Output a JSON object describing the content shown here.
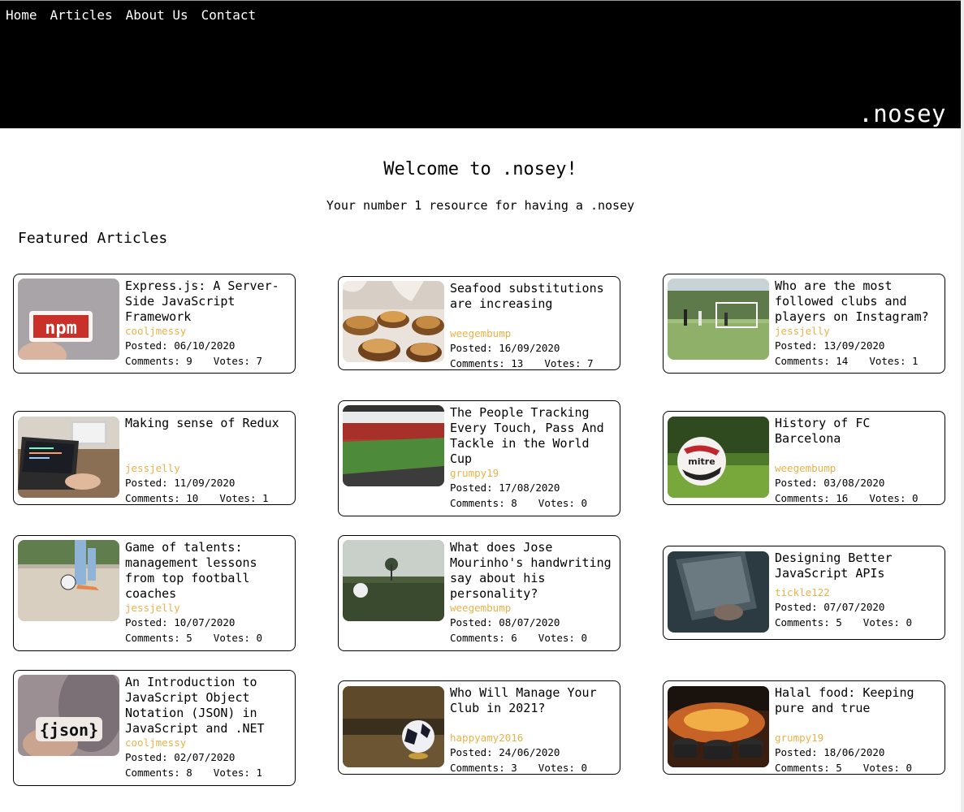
{
  "nav": {
    "items": [
      "Home",
      "Articles",
      "About Us",
      "Contact"
    ],
    "brand": ".nosey"
  },
  "intro": {
    "welcome": "Welcome to .nosey!",
    "tagline": "Your number 1 resource for having a .nosey",
    "featured": "Featured Articles"
  },
  "colors": {
    "author": "#e8b24a",
    "header_bg": "#000000"
  },
  "articles": [
    {
      "title": "Express.js: A Server-Side JavaScript Framework",
      "author": "cooljmessy",
      "posted": "Posted: 06/10/2020",
      "comments": "Comments: 9",
      "votes": "Votes: 7",
      "image": "npm-logo-photo"
    },
    {
      "title": "Seafood substitutions are increasing",
      "author": "weegembump",
      "posted": "Posted: 16/09/2020",
      "comments": "Comments: 13",
      "votes": "Votes: 7",
      "image": "seafood-dish-photo"
    },
    {
      "title": "Who are the most followed clubs and players on Instagram?",
      "author": "jessjelly",
      "posted": "Posted: 13/09/2020",
      "comments": "Comments: 14",
      "votes": "Votes: 1",
      "image": "football-match-photo"
    },
    {
      "title": "Making sense of Redux",
      "author": "jessjelly",
      "posted": "Posted: 11/09/2020",
      "comments": "Comments: 10",
      "votes": "Votes: 1",
      "image": "laptop-coding-photo"
    },
    {
      "title": "The People Tracking Every Touch, Pass And Tackle in the World Cup",
      "author": "grumpy19",
      "posted": "Posted: 17/08/2020",
      "comments": "Comments: 8",
      "votes": "Votes: 0",
      "image": "stadium-photo"
    },
    {
      "title": "History of FC Barcelona",
      "author": "weegembump",
      "posted": "Posted: 03/08/2020",
      "comments": "Comments: 16",
      "votes": "Votes: 0",
      "image": "mitre-ball-photo"
    },
    {
      "title": "Game of talents: management lessons from top football coaches",
      "author": "jessjelly",
      "posted": "Posted: 10/07/2020",
      "comments": "Comments: 5",
      "votes": "Votes: 0",
      "image": "kicking-ball-photo"
    },
    {
      "title": "What does Jose Mourinho's handwriting say about his personality?",
      "author": "weegembump",
      "posted": "Posted: 08/07/2020",
      "comments": "Comments: 6",
      "votes": "Votes: 0",
      "image": "ball-on-field-photo"
    },
    {
      "title": "Designing Better JavaScript APIs",
      "author": "tickle122",
      "posted": "Posted: 07/07/2020",
      "comments": "Comments: 5",
      "votes": "Votes: 0",
      "image": "laptop-dark-photo"
    },
    {
      "title": "An Introduction to JavaScript Object Notation (JSON) in JavaScript and .NET",
      "author": "cooljmessy",
      "posted": "Posted: 02/07/2020",
      "comments": "Comments: 8",
      "votes": "Votes: 1",
      "image": "json-sticker-photo"
    },
    {
      "title": "Who Will Manage Your Club in 2021?",
      "author": "happyamy2016",
      "posted": "Posted: 24/06/2020",
      "comments": "Comments: 3",
      "votes": "Votes: 0",
      "image": "ball-on-stand-photo"
    },
    {
      "title": "Halal food: Keeping pure and true",
      "author": "grumpy19",
      "posted": "Posted: 18/06/2020",
      "comments": "Comments: 5",
      "votes": "Votes: 0",
      "image": "cooking-pots-fire-photo"
    }
  ]
}
